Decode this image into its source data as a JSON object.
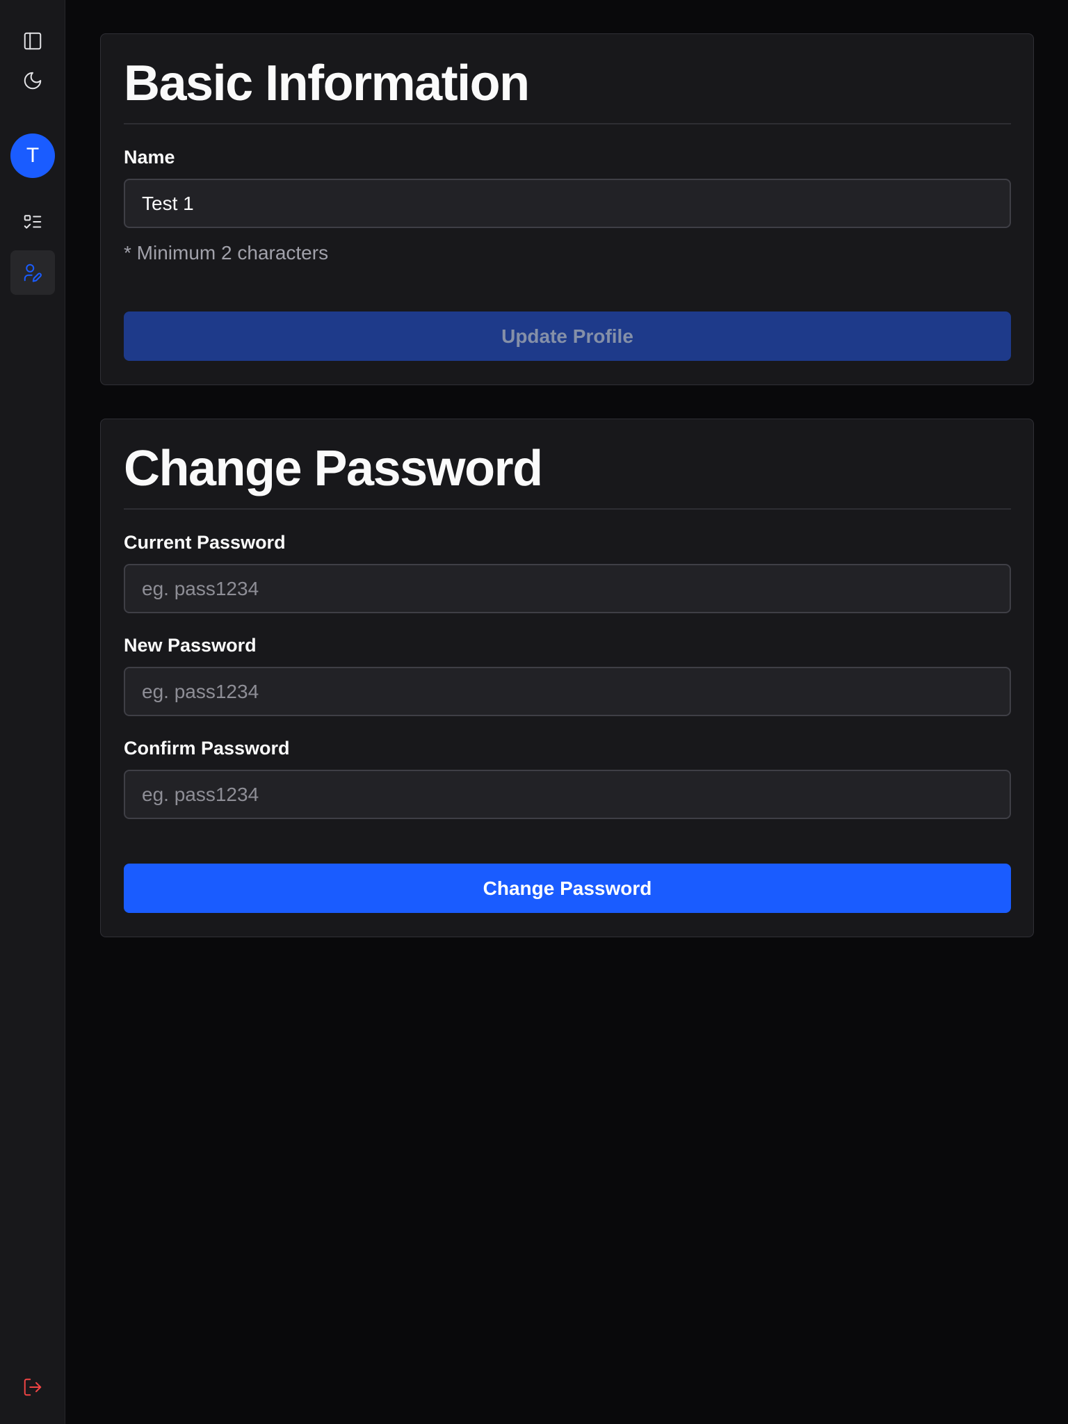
{
  "sidebar": {
    "avatar_initial": "T",
    "icons": {
      "toggle": "panel-left-icon",
      "theme": "moon-icon",
      "tasks": "list-checks-icon",
      "profile": "user-pen-icon",
      "logout": "log-out-icon"
    },
    "active_item": "profile"
  },
  "basic_info": {
    "title": "Basic Information",
    "name_label": "Name",
    "name_value": "Test 1",
    "name_hint": "* Minimum 2 characters",
    "update_button": "Update Profile"
  },
  "change_password": {
    "title": "Change Password",
    "current_label": "Current Password",
    "current_placeholder": "eg. pass1234",
    "new_label": "New Password",
    "new_placeholder": "eg. pass1234",
    "confirm_label": "Confirm Password",
    "confirm_placeholder": "eg. pass1234",
    "submit_button": "Change Password"
  },
  "colors": {
    "accent": "#1a5cff",
    "accent_disabled": "#1e3a8a",
    "logout": "#ef4444",
    "background": "#09090b",
    "panel": "#18181b"
  }
}
